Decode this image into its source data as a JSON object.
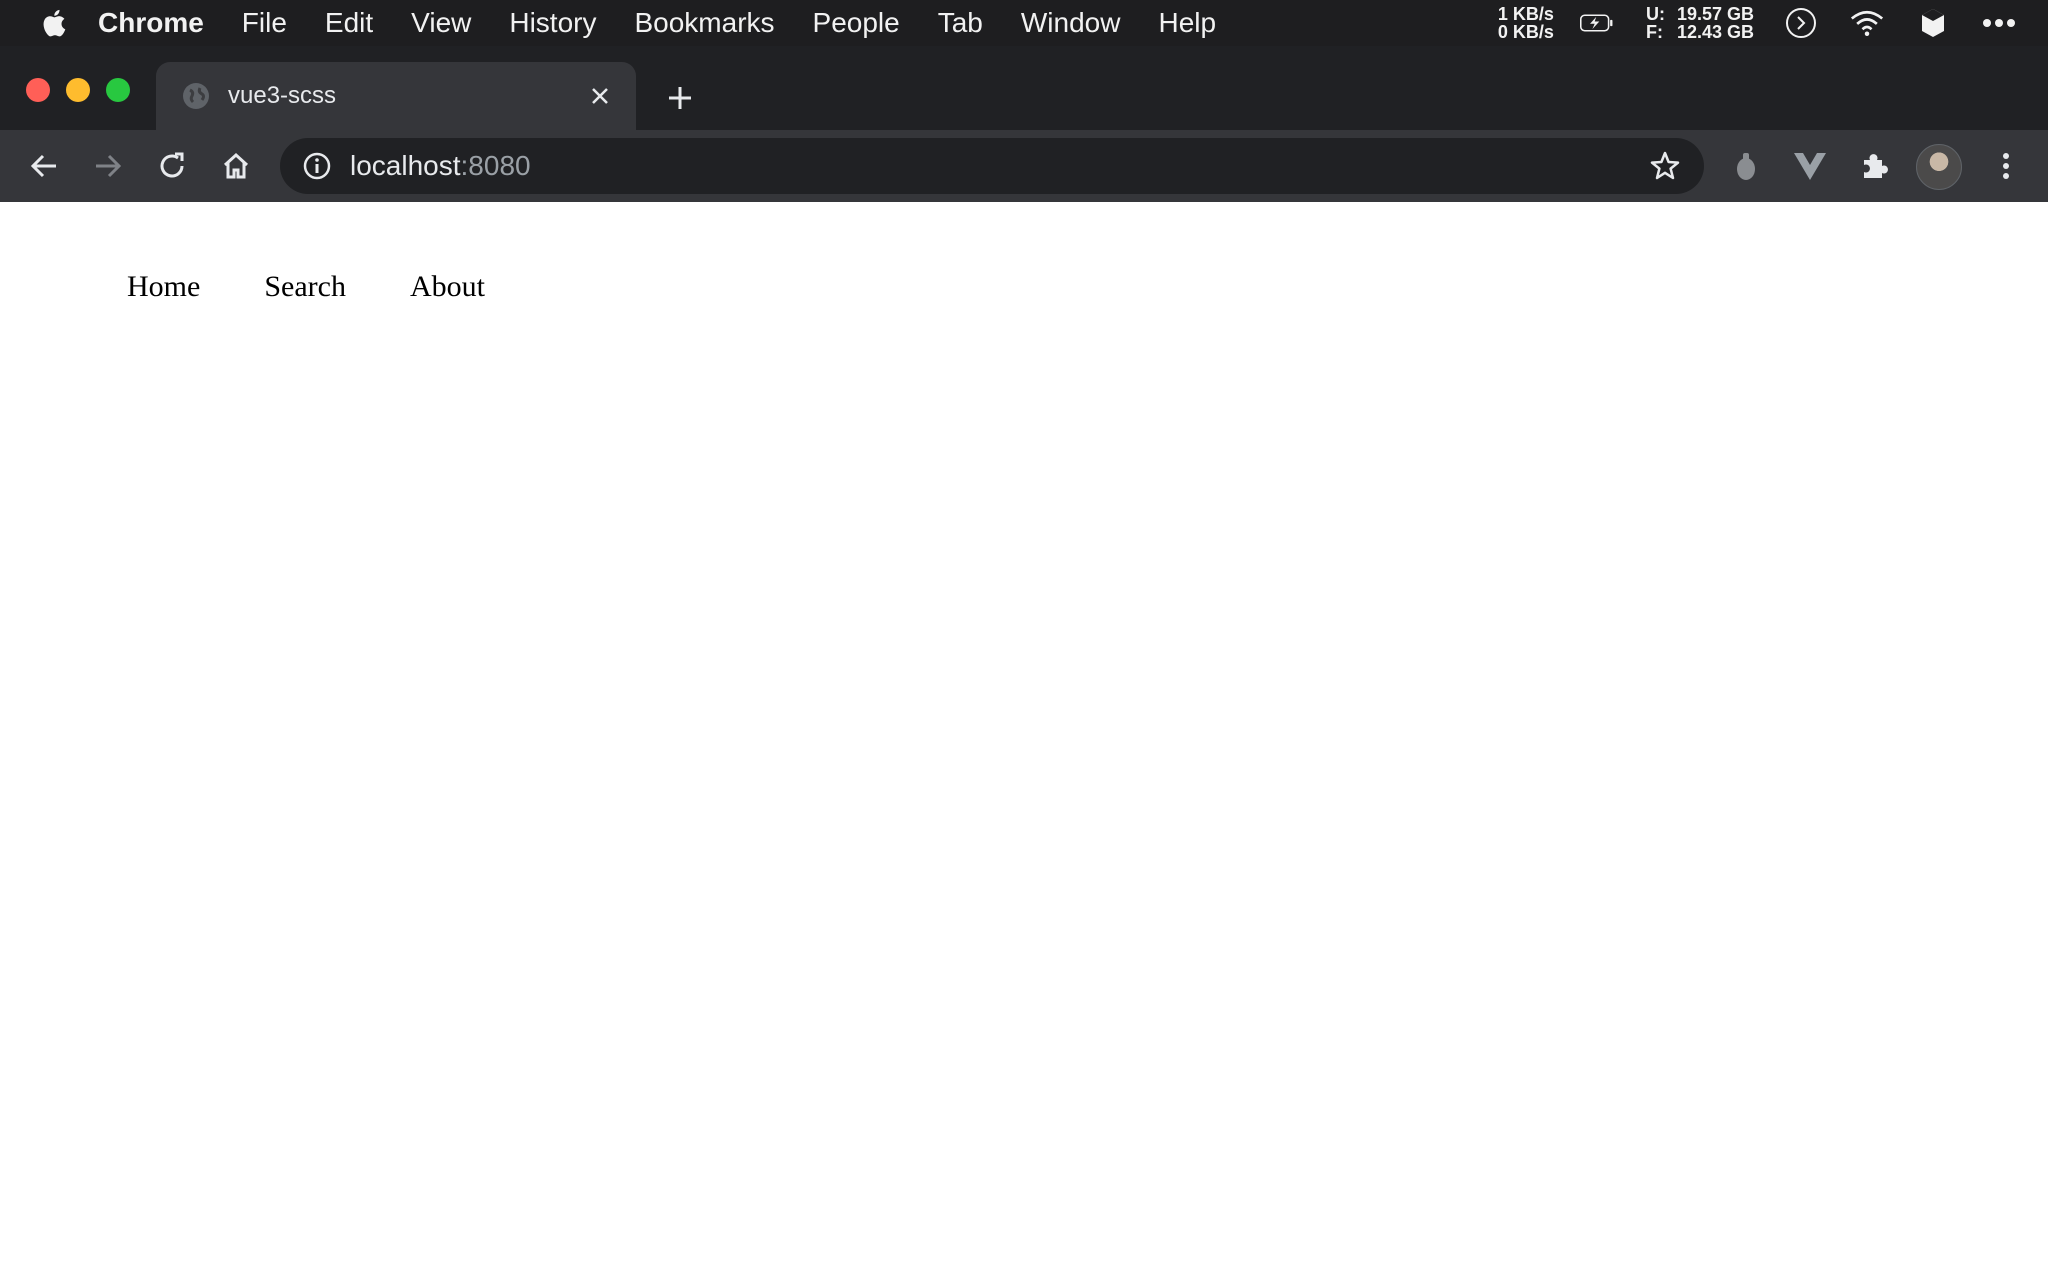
{
  "menubar": {
    "apple_icon": "apple-logo-icon",
    "items": [
      "Chrome",
      "File",
      "Edit",
      "View",
      "History",
      "Bookmarks",
      "People",
      "Tab",
      "Window",
      "Help"
    ],
    "status": {
      "net_up": "1 KB/s",
      "net_down": "0 KB/s",
      "disk_labels": [
        "U:",
        "F:"
      ],
      "disk_values": [
        "19.57 GB",
        "12.43 GB"
      ],
      "icons": [
        "battery-charging-icon",
        "chevron-circle-icon",
        "wifi-icon",
        "cube-icon",
        "more-icon"
      ]
    }
  },
  "browser": {
    "tab": {
      "title": "vue3-scss",
      "favicon": "globe-icon"
    },
    "url": {
      "host": "localhost",
      "port": ":8080"
    },
    "toolbar_icons": [
      "back-icon",
      "forward-icon",
      "reload-icon",
      "home-icon",
      "info-icon",
      "star-icon",
      "extension-icon",
      "vue-devtools-icon",
      "puzzle-icon",
      "profile-avatar",
      "kebab-menu-icon"
    ]
  },
  "page": {
    "nav": [
      "Home",
      "Search",
      "About"
    ]
  },
  "colors": {
    "menubar_bg": "#1e1e20",
    "tabstrip_bg": "#202124",
    "toolbar_bg": "#35363a",
    "page_bg": "#ffffff"
  }
}
